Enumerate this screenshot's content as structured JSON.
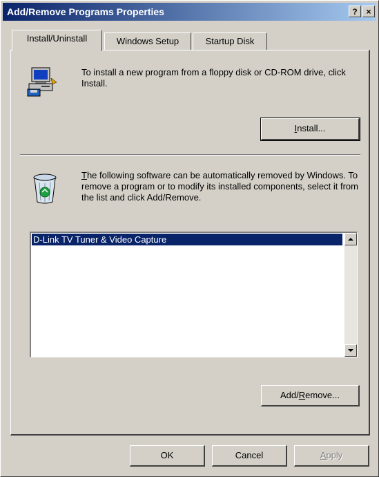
{
  "window": {
    "title": "Add/Remove Programs Properties"
  },
  "titlebar_buttons": {
    "help": "?",
    "close": "×"
  },
  "tabs": [
    {
      "label": "Install/Uninstall",
      "active": true
    },
    {
      "label": "Windows Setup",
      "active": false
    },
    {
      "label": "Startup Disk",
      "active": false
    }
  ],
  "install": {
    "text": "To install a new program from a floppy disk or CD-ROM drive, click Install.",
    "button_rest": "nstall...",
    "button_mnemonic": "I"
  },
  "remove": {
    "text_mnemonic": "T",
    "text_rest": "he following software can be automatically removed by Windows. To remove a program or to modify its installed components, select it from the list and click Add/Remove.",
    "list_items": [
      "D-Link TV Tuner & Video Capture"
    ],
    "button_prefix": "Add/",
    "button_mnemonic": "R",
    "button_suffix": "emove..."
  },
  "footer": {
    "ok": "OK",
    "cancel": "Cancel",
    "apply_mnemonic": "A",
    "apply_rest": "pply"
  },
  "icons": {
    "install": "computer-with-disk-icon",
    "remove": "recycle-bin-icon"
  },
  "colors": {
    "titlebar_start": "#0a246a",
    "titlebar_end": "#a6caf0",
    "selection": "#0a246a",
    "face": "#d4d0c8"
  }
}
